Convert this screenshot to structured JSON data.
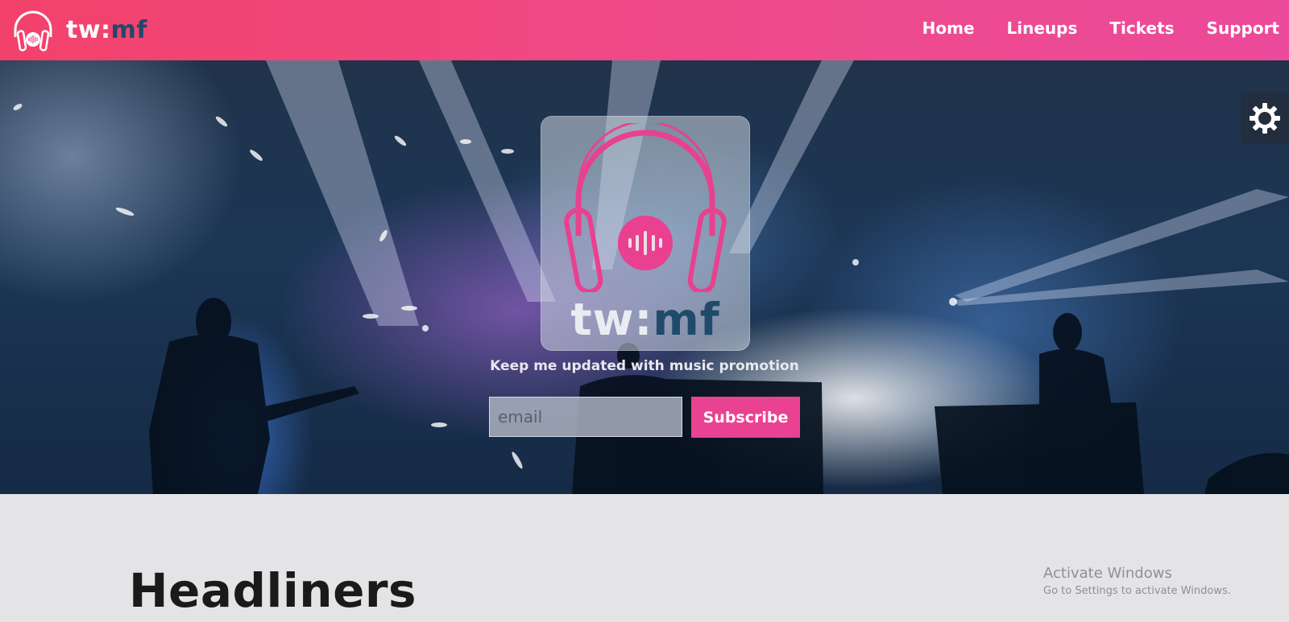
{
  "navbar": {
    "brand": {
      "tw": "tw:",
      "mf": "mf"
    },
    "links": [
      "Home",
      "Lineups",
      "Tickets",
      "Support"
    ]
  },
  "hero": {
    "logo": {
      "tw": "tw:",
      "mf": "mf"
    },
    "promo_text": "Keep me updated with music promotion",
    "email_placeholder": "email",
    "subscribe_label": "Subscribe",
    "theme_toggle_icon": "sun-icon"
  },
  "main": {
    "section_title": "Headliners"
  },
  "watermark": {
    "title": "Activate Windows",
    "subtitle": "Go to Settings to activate Windows."
  },
  "colors": {
    "navbar_start": "#f2426b",
    "navbar_end": "#ec4a9a",
    "accent_pink": "#ea4292",
    "brand_navy": "#1f4a6b",
    "page_background": "#e4e4e6"
  }
}
